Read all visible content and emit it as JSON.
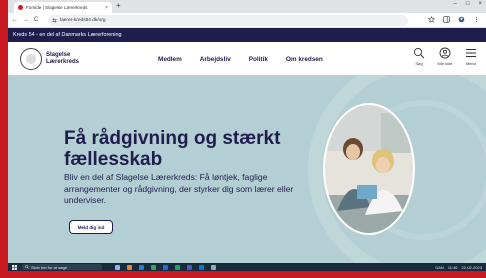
{
  "browser": {
    "tab_title": "Forside | Slagelse Lærerkreds",
    "tab_close": "×",
    "new_tab": "+",
    "url": "laerer-kreds54.dk/org",
    "win_min": "–",
    "win_max": "□",
    "win_close": "×",
    "back": "←",
    "forward": "→",
    "reload": "C"
  },
  "site": {
    "banner": "Kreds 54 - en del af Danmarks Lærerforening",
    "logo_line1": "Slagelse",
    "logo_line2": "Lærerkreds",
    "menu": [
      "Medlem",
      "Arbejdsliv",
      "Politik",
      "Om kredsen"
    ],
    "tools": [
      {
        "label": "Søg",
        "icon": "search-icon"
      },
      {
        "label": "Min side",
        "icon": "user-icon"
      },
      {
        "label": "Menu",
        "icon": "hamburger-icon"
      }
    ]
  },
  "hero": {
    "heading": "Få rådgivning og stærkt fællesskab",
    "lead": "Bliv en del af Slagelse Lærerkreds: Få løntjek, faglige arrangementer og rådgivning, der styrker dig som lærer eller underviser.",
    "cta": "Meld dig ind"
  },
  "taskbar": {
    "search_placeholder": "Skriv her for at søge",
    "time": "11:46",
    "date": "22-02-2023",
    "lang": "DAN"
  },
  "colors": {
    "navy": "#1f1d4e",
    "hero_bg": "#b4cfd3",
    "frame_red": "#c81a20"
  }
}
